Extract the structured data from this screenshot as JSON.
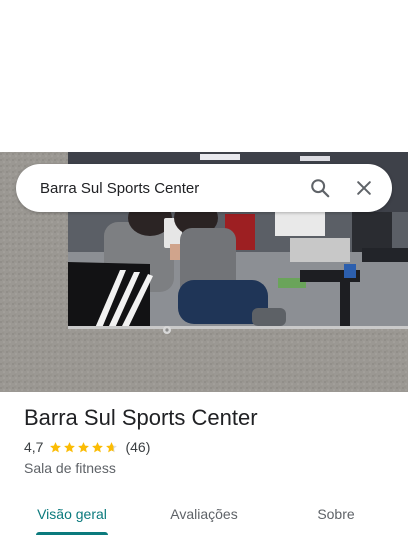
{
  "search": {
    "query": "Barra Sul Sports Center"
  },
  "place": {
    "name": "Barra Sul Sports Center",
    "rating": "4,7",
    "rating_stars": 4.7,
    "review_count": "(46)",
    "category": "Sala de fitness"
  },
  "tabs": [
    {
      "label": "Visão geral",
      "active": true
    },
    {
      "label": "Avaliações",
      "active": false
    },
    {
      "label": "Sobre",
      "active": false
    }
  ],
  "colors": {
    "accent": "#0b7a7d",
    "star": "#fbbc04",
    "text_primary": "#202124",
    "text_secondary": "#5f6368"
  },
  "icons": [
    "search-icon",
    "close-icon",
    "star-icon"
  ]
}
